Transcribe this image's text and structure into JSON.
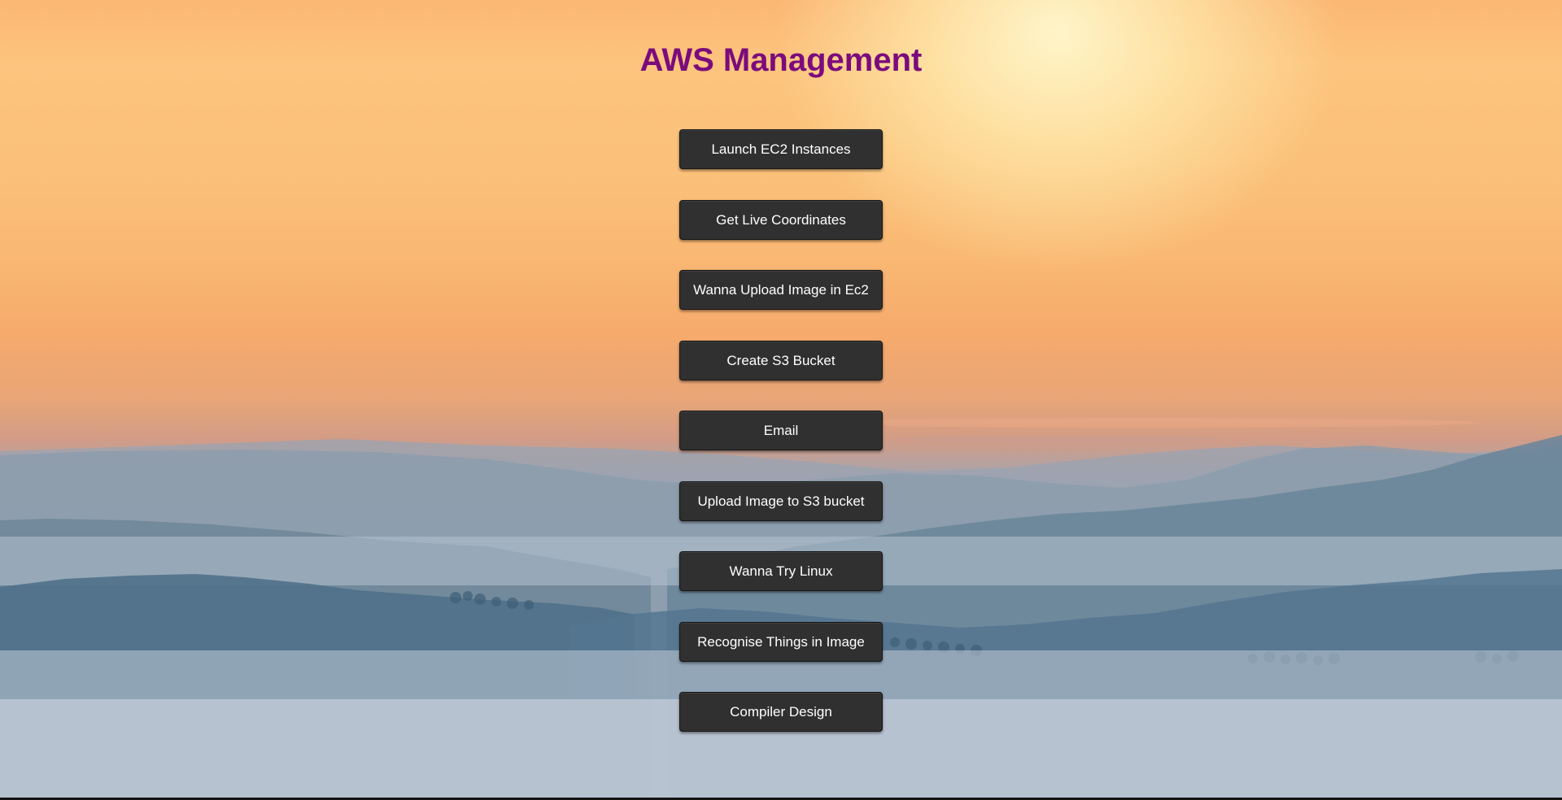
{
  "page": {
    "title": "AWS Management",
    "title_color": "#7b0b7d"
  },
  "menu": {
    "button_bg": "#303030",
    "button_text_color": "#ffffff",
    "buttons": [
      {
        "label": "Launch EC2 Instances"
      },
      {
        "label": "Get Live Coordinates"
      },
      {
        "label": "Wanna Upload Image in Ec2"
      },
      {
        "label": "Create S3 Bucket"
      },
      {
        "label": "Email"
      },
      {
        "label": "Upload Image to S3 bucket"
      },
      {
        "label": "Wanna Try Linux"
      },
      {
        "label": "Recognise Things in Image"
      },
      {
        "label": "Compiler Design"
      }
    ]
  },
  "background": {
    "image": "misty-mountains-sunrise"
  }
}
